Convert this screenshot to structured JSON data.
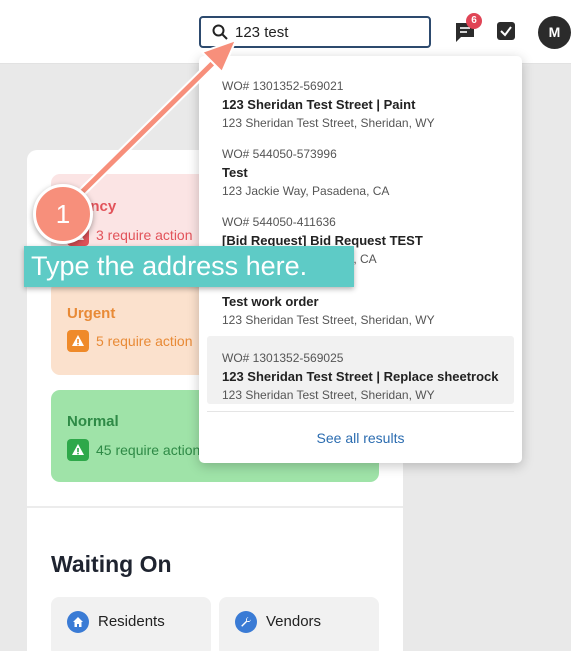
{
  "search": {
    "value": "123 test",
    "icon": "search-icon"
  },
  "header": {
    "notification_count": "6",
    "avatar_initial": "M"
  },
  "cards": [
    {
      "title": "Emergency",
      "title_visible": "rgency",
      "action": "3 require action",
      "color": "#e2535a"
    },
    {
      "title": "Urgent",
      "action": "5 require action",
      "color": "#ef8a2a"
    },
    {
      "title": "Normal",
      "action": "45 require action",
      "color": "#2ea84a"
    }
  ],
  "waiting": {
    "title": "Waiting On",
    "buttons": [
      {
        "label": "Residents",
        "icon": "home-icon"
      },
      {
        "label": "Vendors",
        "icon": "wrench-icon"
      }
    ]
  },
  "results": [
    {
      "wo": "WO# 1301352-569021",
      "name": "123 Sheridan Test Street | Paint",
      "address": "123 Sheridan Test Street, Sheridan, WY"
    },
    {
      "wo": "WO# 544050-573996",
      "name": "Test",
      "address": "123 Jackie Way, Pasadena, CA"
    },
    {
      "wo": "WO# 544050-411636",
      "name": "[Bid Request] Bid Request TEST",
      "address": "na, CA"
    },
    {
      "wo": "",
      "name": "Test work order",
      "address": "123 Sheridan Test Street, Sheridan, WY"
    },
    {
      "wo": "WO# 1301352-569025",
      "name": "123 Sheridan Test Street | Replace sheetrock",
      "address": "123 Sheridan Test Street, Sheridan, WY"
    }
  ],
  "see_all": "See all results",
  "annotation": {
    "step": "1",
    "tip": "Type the address here."
  },
  "colors": {
    "accent": "#2b6cb0",
    "annotation": "#f78f7b",
    "tip_bg": "#5ecbc6"
  }
}
